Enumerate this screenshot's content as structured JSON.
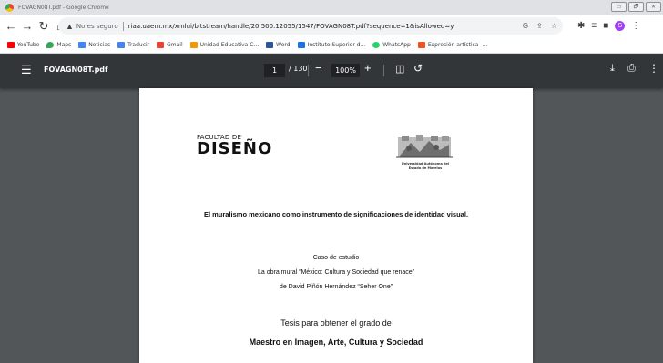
{
  "window": {
    "title": "FOVAGN08T.pdf - Google Chrome",
    "buttons": [
      "▭",
      "🗗",
      "✕"
    ]
  },
  "toolbar": {
    "security_text": "No es seguro",
    "url": "riaa.uaem.mx/xmlui/bitstream/handle/20.500.12055/1547/FOVAGN08T.pdf?sequence=1&isAllowed=y",
    "profile_initial": "S"
  },
  "bookmarks": [
    {
      "label": "YouTube",
      "color": "#ff0000"
    },
    {
      "label": "Maps",
      "color": "#34a853"
    },
    {
      "label": "Noticias",
      "color": "#4285f4"
    },
    {
      "label": "Traducir",
      "color": "#4285f4"
    },
    {
      "label": "Gmail",
      "color": "#ea4335"
    },
    {
      "label": "Unidad Educativa C...",
      "color": "#f29900"
    },
    {
      "label": "Word",
      "color": "#2b579a"
    },
    {
      "label": "Instituto Superior d...",
      "color": "#1a73e8"
    },
    {
      "label": "WhatsApp",
      "color": "#25d366"
    },
    {
      "label": "Expresión artística -...",
      "color": "#f4511e"
    }
  ],
  "pdf_viewer": {
    "file_name": "FOVAGN08T.pdf",
    "current_page": "1",
    "page_count": "/ 130",
    "zoom": "100%"
  },
  "document": {
    "logo_small": "FACULTAD DE",
    "logo_big": "DISEÑO",
    "university_line1": "Universidad Autónoma del",
    "university_line2": "Estado de Morelos",
    "title": "El muralismo mexicano como instrumento de significaciones de identidad visual.",
    "case_study": "Caso de estudio",
    "mural": "La obra mural  “México: Cultura y Sociedad que renace”",
    "author": "de David Piñón Hernández “Seher One”",
    "thesis": "Tesis para obtener el grado de",
    "degree": "Maestro en Imagen, Arte, Cultura y Sociedad"
  },
  "colors": {
    "viewer_bg": "#525659",
    "pdf_toolbar": "#323639",
    "profile": "#a142f4"
  }
}
